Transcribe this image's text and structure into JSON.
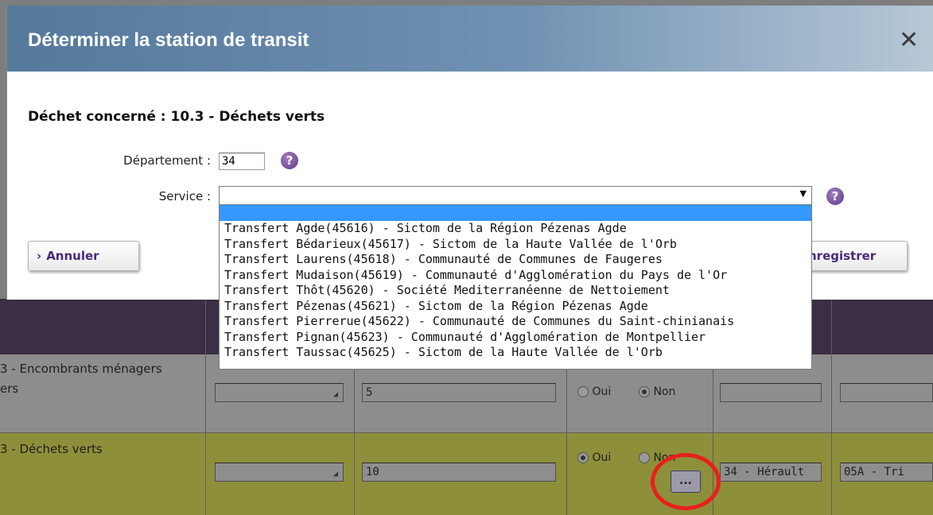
{
  "dialog": {
    "title": "Déterminer la station de transit",
    "close_glyph": "✕",
    "waste_label": "Déchet concerné : 10.3 - Déchets verts",
    "department": {
      "label": "Département :",
      "value": "34"
    },
    "service": {
      "label": "Service :",
      "selected_value": "",
      "options": [
        "Transfert Agde(45616) - Sictom de la Région Pézenas Agde",
        "Transfert Bédarieux(45617) - Sictom de la Haute Vallée de l'Orb",
        "Transfert Laurens(45618) - Communauté de Communes de Faugeres",
        "Transfert Mudaison(45619) - Communauté d'Agglomération du Pays de l'Or",
        "Transfert Thôt(45620) - Société Mediterranéenne de Nettoiement",
        "Transfert Pézenas(45621) - Sictom de la Région Pézenas Agde",
        "Transfert Pierrerue(45622) - Communauté de Communes du Saint-chinianais",
        "Transfert Pignan(45623) - Communauté d'Agglomération de Montpellier",
        "Transfert Taussac(45625) - Sictom de la Haute Vallée de l'Orb"
      ]
    },
    "help_glyph": "?",
    "buttons": {
      "cancel": "Annuler",
      "save": "nregistrer",
      "chevron": "›"
    }
  },
  "table": {
    "rows": [
      {
        "label_line1": "3 - Encombrants ménagers",
        "label_line2": "ers",
        "quantity": "5",
        "oui": "Oui",
        "non": "Non",
        "selected": "Non",
        "department": "",
        "treatment": ""
      },
      {
        "label_line1": "3 - Déchets verts",
        "quantity": "10",
        "oui": "Oui",
        "non": "Non",
        "selected": "Oui",
        "department": "34 - Hérault",
        "treatment": "05A - Tri",
        "dots_button": "..."
      }
    ]
  },
  "colors": {
    "title_bar": "#55799b",
    "accent_purple": "#4a2a7a",
    "highlight_blue": "#3399ff",
    "annotation_red": "#e8201d"
  }
}
